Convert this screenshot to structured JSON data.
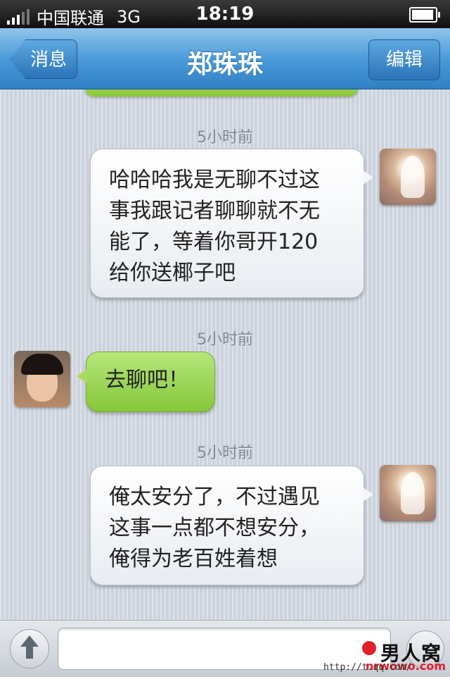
{
  "status_bar": {
    "carrier": "中国联通",
    "network": "3G",
    "time": "18:19"
  },
  "nav": {
    "back_label": "消息",
    "title": "郑珠珠",
    "edit_label": "编辑"
  },
  "messages": [
    {
      "timestamp": "5小时前",
      "side": "right",
      "lines": [
        "哈哈哈我是无聊不过这",
        "事我跟记者聊聊就不无",
        "能了，等着你哥开120",
        "给你送椰子吧"
      ]
    },
    {
      "timestamp": "5小时前",
      "side": "left",
      "lines": [
        "去聊吧！"
      ]
    },
    {
      "timestamp": "5小时前",
      "side": "right",
      "lines": [
        "俺太安分了，不过遇见",
        "这事一点都不想安分，",
        "俺得为老百姓着想"
      ]
    }
  ],
  "input": {
    "placeholder": ""
  },
  "watermark": {
    "logo": "男人窝",
    "domain": "nrwowo.com",
    "url": "http://t.qq.com/"
  },
  "colors": {
    "nav_blue": "#4b9bd8",
    "outgoing_bubble": "#f6f7f9",
    "incoming_bubble": "#a8dc5c"
  }
}
